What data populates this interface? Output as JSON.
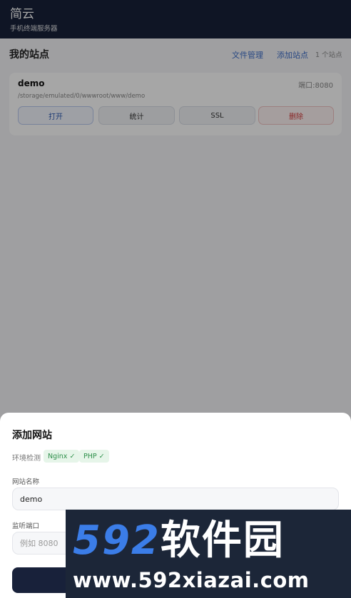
{
  "app": {
    "title": "简云",
    "subtitle": "手机终端服务器"
  },
  "sites_header": {
    "title": "我的站点",
    "file_manager": "文件管理",
    "add_site": "添加站点",
    "count": "1 个站点"
  },
  "site": {
    "name": "demo",
    "port": "端口:8080",
    "path": "/storage/emulated/0/wwwroot/www/demo",
    "actions": {
      "open": "打开",
      "stats": "统计",
      "ssl": "SSL",
      "delete": "删除"
    }
  },
  "sheet": {
    "title": "添加网站",
    "env_label": "环境检测",
    "nginx_badge": "Nginx ✓",
    "php_badge": "PHP ✓",
    "name_label": "网站名称",
    "name_value": "demo",
    "port_label": "监听端口",
    "port_placeholder": "例如 8080"
  },
  "watermark": {
    "brand_num": "592",
    "brand_cn": "软件园",
    "url": "www.592xiazai.com"
  },
  "colors": {
    "header_bg": "#18213a",
    "accent_link": "#3f6fc9",
    "ok_green": "#2e8f4a",
    "danger_red": "#d43c3c"
  }
}
